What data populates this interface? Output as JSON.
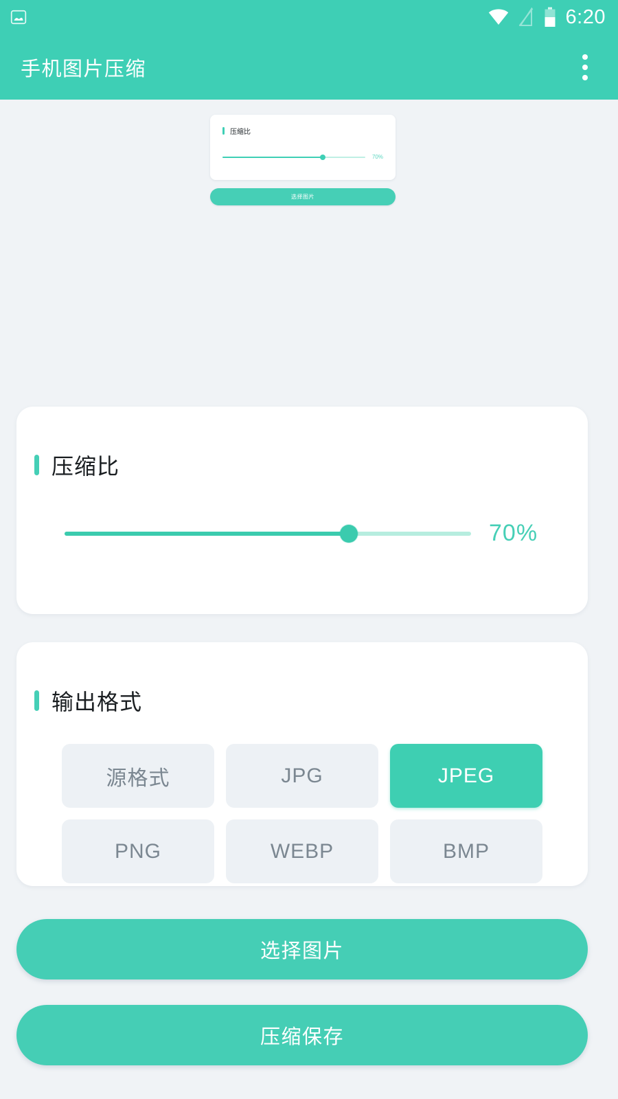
{
  "theme": {
    "accent": "#3ECFB5",
    "accent_dark": "#3BCBAE",
    "page_background": "#F0F3F6",
    "card_background": "#FFFFFF",
    "chip_unselected_background": "#EDF1F5",
    "chip_unselected_text": "#7B8791",
    "chip_selected_background": "#3ECFB2",
    "title_text": "#1A1E21",
    "slider_value_text": "#46CFB6"
  },
  "status_bar": {
    "time": "6:20",
    "icons": {
      "notification": "photo-notification-icon",
      "wifi": "wifi-icon",
      "signal": "signal-off-icon",
      "battery": "battery-half-icon"
    },
    "battery_level_percent": 50
  },
  "app_bar": {
    "title": "手机图片压缩",
    "overflow_icon": "more-vert-icon"
  },
  "mini_preview": {
    "card_title": "压缩比",
    "slider_value_label": "70%",
    "slider_percent": 70,
    "button_label": "选择图片"
  },
  "ratio_card": {
    "title": "压缩比",
    "slider": {
      "value_label": "70%",
      "value": 70,
      "min": 0,
      "max": 100
    }
  },
  "format_card": {
    "title": "输出格式",
    "options": [
      {
        "label": "源格式",
        "selected": false
      },
      {
        "label": "JPG",
        "selected": false
      },
      {
        "label": "JPEG",
        "selected": true
      },
      {
        "label": "PNG",
        "selected": false
      },
      {
        "label": "WEBP",
        "selected": false
      },
      {
        "label": "BMP",
        "selected": false
      }
    ],
    "selected_option": "JPEG"
  },
  "actions": {
    "select_image_label": "选择图片",
    "compress_save_label": "压缩保存"
  }
}
